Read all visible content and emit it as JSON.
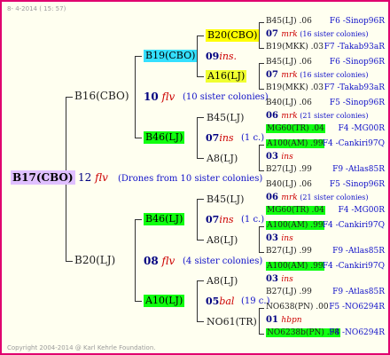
{
  "header": {
    "date": "8-  4-2014 ( 15: 57)"
  },
  "footer": {
    "copyright": "Copyright 2004-2014 @ Karl Kehrle Foundation."
  },
  "g1": {
    "name": "B17(CBO)",
    "year": "12",
    "mark": "flv",
    "note": "(Drones from 10 sister colonies)"
  },
  "g2": [
    {
      "name": "B16(CBO)",
      "year": "10",
      "mark": "flv",
      "note": "(10 sister colonies)"
    },
    {
      "name": "B20(LJ)",
      "year": "08",
      "mark": "flv",
      "note": "(4 sister colonies)"
    }
  ],
  "g3": [
    {
      "name": "B19(CBO)",
      "year": "09",
      "mark": "ins.",
      "note": ""
    },
    {
      "name": "B46(LJ)",
      "year": "07",
      "mark": "ins",
      "note": "(1 c.)"
    },
    {
      "name": "B46(LJ)",
      "year": "07",
      "mark": "ins",
      "note": "(1 c.)"
    },
    {
      "name": "A10(LJ)",
      "year": "05",
      "mark": "bal",
      "note": "(19 c.)"
    }
  ],
  "g4": [
    {
      "name": "B20(CBO)"
    },
    {
      "name": "A16(LJ)"
    },
    {
      "name": "B45(LJ)"
    },
    {
      "name": "A8(LJ)"
    },
    {
      "name": "B45(LJ)"
    },
    {
      "name": "A8(LJ)"
    },
    {
      "name": "A8(LJ)"
    },
    {
      "name": "NO61(TR)"
    }
  ],
  "g5": [
    {
      "kind": "parent",
      "name": "B45(LJ)",
      "val": ".06",
      "right": "F6 -Sinop96R",
      "box": ""
    },
    {
      "kind": "year",
      "year": "07",
      "mark": "mrk",
      "note": "(16 sister colonies)"
    },
    {
      "kind": "parent",
      "name": "B19(MKK)",
      "val": ".03",
      "right": "F7 -Takab93aR",
      "box": ""
    },
    {
      "kind": "parent",
      "name": "B45(LJ)",
      "val": ".06",
      "right": "F6 -Sinop96R",
      "box": ""
    },
    {
      "kind": "year",
      "year": "07",
      "mark": "mrk",
      "note": "(16 sister colonies)"
    },
    {
      "kind": "parent",
      "name": "B19(MKK)",
      "val": ".03",
      "right": "F7 -Takab93aR",
      "box": ""
    },
    {
      "kind": "parent",
      "name": "B40(LJ)",
      "val": ".06",
      "right": "F5 -Sinop96R",
      "box": ""
    },
    {
      "kind": "year",
      "year": "06",
      "mark": "mrk",
      "note": "(21 sister colonies)"
    },
    {
      "kind": "parent",
      "name": "MG60(TR)",
      "val": ".04",
      "right": "F4 -MG00R",
      "box": "green"
    },
    {
      "kind": "parent",
      "name": "A100(AM)",
      "val": ".99",
      "right": "F4 -Cankiri97Q",
      "box": "green"
    },
    {
      "kind": "year",
      "year": "03",
      "mark": "ins",
      "note": ""
    },
    {
      "kind": "parent",
      "name": "B27(LJ)",
      "val": ".99",
      "right": "F9 -Atlas85R",
      "box": ""
    },
    {
      "kind": "parent",
      "name": "B40(LJ)",
      "val": ".06",
      "right": "F5 -Sinop96R",
      "box": ""
    },
    {
      "kind": "year",
      "year": "06",
      "mark": "mrk",
      "note": "(21 sister colonies)"
    },
    {
      "kind": "parent",
      "name": "MG60(TR)",
      "val": ".04",
      "right": "F4 -MG00R",
      "box": "green"
    },
    {
      "kind": "parent",
      "name": "A100(AM)",
      "val": ".99",
      "right": "F4 -Cankiri97Q",
      "box": "green"
    },
    {
      "kind": "year",
      "year": "03",
      "mark": "ins",
      "note": ""
    },
    {
      "kind": "parent",
      "name": "B27(LJ)",
      "val": ".99",
      "right": "F9 -Atlas85R",
      "box": ""
    },
    {
      "kind": "parent",
      "name": "A100(AM)",
      "val": ".99",
      "right": "F4 -Cankiri97Q",
      "box": "green"
    },
    {
      "kind": "year",
      "year": "03",
      "mark": "ins",
      "note": ""
    },
    {
      "kind": "parent",
      "name": "B27(LJ)",
      "val": ".99",
      "right": "F9 -Atlas85R",
      "box": ""
    },
    {
      "kind": "parent",
      "name": "NO638(PN)",
      "val": ".00",
      "right": "F5 -NO6294R",
      "box": ""
    },
    {
      "kind": "year",
      "year": "01",
      "mark": "hbpn",
      "note": ""
    },
    {
      "kind": "parent",
      "name": "NO6238b(PN)",
      "val": ".98",
      "right": "F4 -NO6294R",
      "box": "green"
    }
  ]
}
